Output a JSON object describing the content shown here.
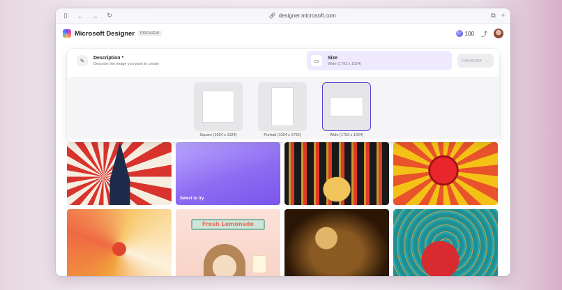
{
  "browser": {
    "url": "designer.microsoft.com"
  },
  "app": {
    "name": "Microsoft Designer",
    "badge": "PREVIEW",
    "credits": "100"
  },
  "prompt": {
    "description": {
      "title": "Description *",
      "placeholder": "Describe the image you want to create"
    },
    "size": {
      "title": "Size",
      "value": "Wide (1792 x 1024)"
    },
    "generate_label": "Generate"
  },
  "size_options": [
    {
      "label": "Square (1024 x 1024)",
      "selected": false
    },
    {
      "label": "Portrait (1024 x 1792)",
      "selected": false
    },
    {
      "label": "Wide (1792 x 1024)",
      "selected": true
    }
  ],
  "gallery": {
    "hint": "Select to try",
    "sign_text": "Fresh Lemonade"
  },
  "colors": {
    "accent": "#5a3fd6",
    "size_field_bg": "#efe9ff"
  },
  "icons": [
    "sidebar-icon",
    "back-icon",
    "forward-icon",
    "refresh-icon",
    "link-icon",
    "share-icon",
    "profile-icon",
    "prompt-icon",
    "aspect-icon",
    "arrow-right-icon"
  ]
}
